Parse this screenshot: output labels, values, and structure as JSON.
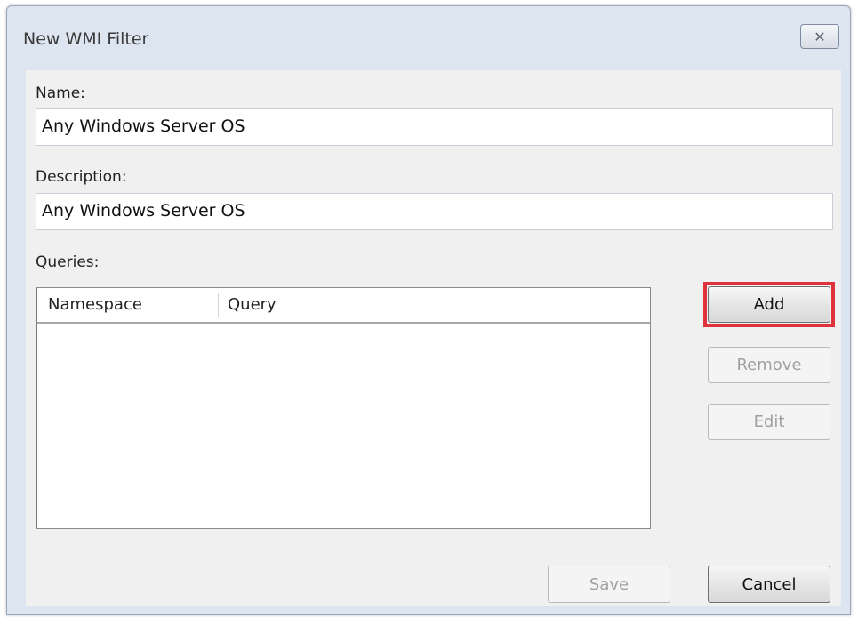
{
  "window": {
    "title": "New WMI Filter",
    "close_glyph": "✕"
  },
  "form": {
    "name_label": "Name:",
    "name_value": "Any Windows Server OS",
    "description_label": "Description:",
    "description_value": "Any Windows Server OS",
    "queries_label": "Queries:"
  },
  "queries_table": {
    "columns": [
      "Namespace",
      "Query"
    ],
    "rows": []
  },
  "buttons": {
    "add": "Add",
    "remove": "Remove",
    "edit": "Edit",
    "save": "Save",
    "cancel": "Cancel"
  },
  "colors": {
    "highlight": "#e0323c"
  }
}
